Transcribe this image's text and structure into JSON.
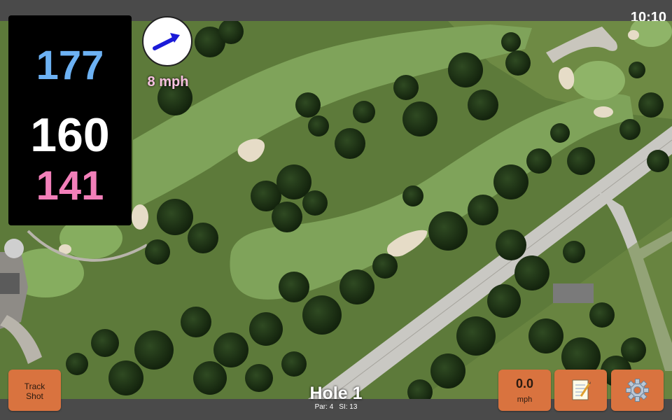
{
  "status": {
    "time": "10:10"
  },
  "distances": {
    "back": "177",
    "middle": "160",
    "front": "141"
  },
  "wind": {
    "speed_label": "8 mph",
    "icon": "wind-direction-arrow-icon",
    "direction": "north-east"
  },
  "buttons": {
    "track_shot": {
      "line1": "Track",
      "line2": "Shot"
    },
    "shot_speed": {
      "value": "0.0",
      "unit": "mph"
    },
    "notes_icon": "notepad-icon",
    "settings_icon": "gear-icon"
  },
  "hole": {
    "title": "Hole 1",
    "par": "Par: 4",
    "si": "SI: 13"
  },
  "colors": {
    "back_distance": "#6cb1f3",
    "middle_distance": "#ffffff",
    "front_distance": "#f27fb9",
    "button_bg": "#d9733f",
    "bar_bg": "#4a4a4a"
  }
}
